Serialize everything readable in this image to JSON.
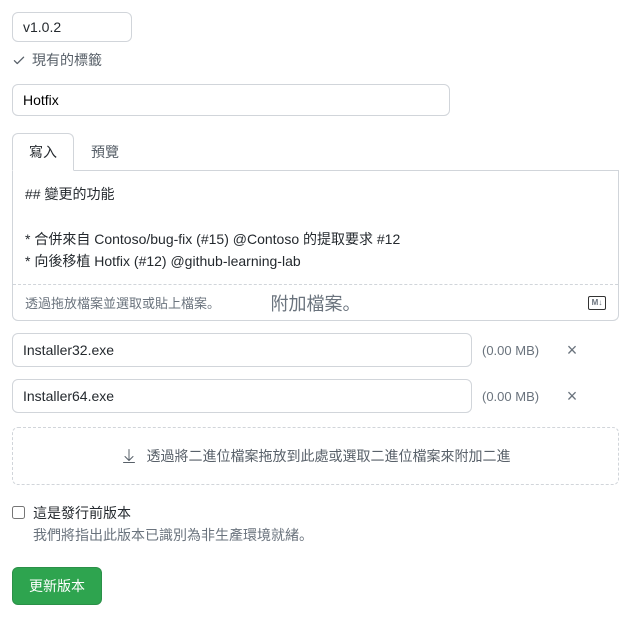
{
  "tag": {
    "value": "v1.0.2",
    "existing_label": "現有的標籤"
  },
  "title": {
    "value": "Hotfix"
  },
  "tabs": {
    "write": "寫入",
    "preview": "預覽"
  },
  "description": {
    "content": "## 變更的功能\n\n* 合併來自 Contoso/bug-fix (#15) @Contoso 的提取要求 #12\n* 向後移植 Hotfix (#12) @github-learning-lab",
    "attach_hint": "透過拖放檔案並選取或貼上檔案。",
    "attach_overlay": "附加檔案。"
  },
  "binaries": [
    {
      "name": "Installer32.exe",
      "size": "(0.00 MB)"
    },
    {
      "name": "Installer64.exe",
      "size": "(0.00 MB)"
    }
  ],
  "dropzone": {
    "text": "透過將二進位檔案拖放到此處或選取二進位檔案來附加二進"
  },
  "prerelease": {
    "label": "這是發行前版本",
    "desc": "我們將指出此版本已識別為非生產環境就緒。"
  },
  "buttons": {
    "update": "更新版本"
  }
}
